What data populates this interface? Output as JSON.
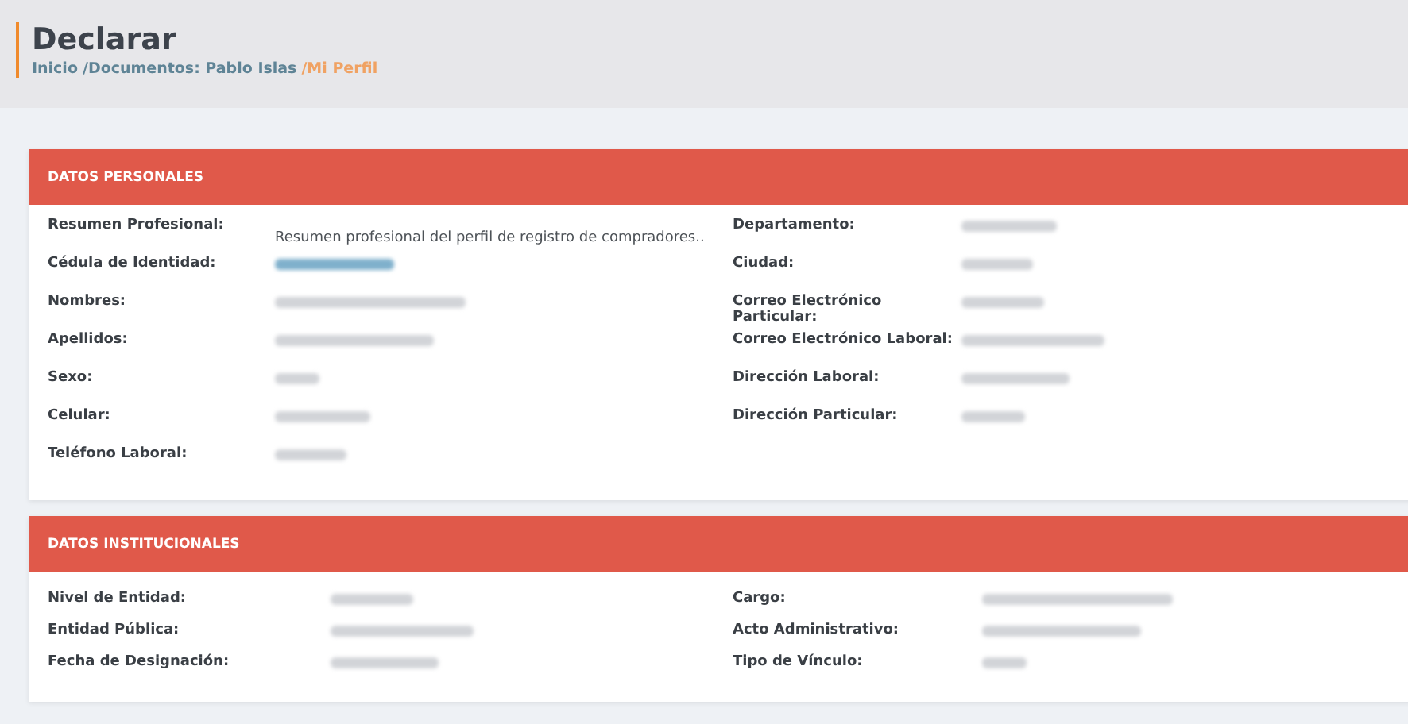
{
  "page_header": {
    "title": "Declarar",
    "breadcrumb": [
      {
        "label": "Inicio",
        "current": false
      },
      {
        "label": "/Documentos: Pablo Islas",
        "current": false
      },
      {
        "label": "/Mi Perfil",
        "current": true
      }
    ]
  },
  "sections": [
    {
      "title": "DATOS PERSONALES",
      "columns": [
        [
          {
            "label": "Resumen Profesional:",
            "kind": "text",
            "value": "Resumen profesional del perfil de registro de compradores.."
          },
          {
            "label": "Cédula de Identidad:",
            "kind": "blurred-link"
          },
          {
            "label": "Nombres:",
            "kind": "blurred"
          },
          {
            "label": "Apellidos:",
            "kind": "blurred"
          },
          {
            "label": "Sexo:",
            "kind": "blurred"
          },
          {
            "label": "Celular:",
            "kind": "blurred"
          },
          {
            "label": "Teléfono Laboral:",
            "kind": "blurred"
          }
        ],
        [
          {
            "label": "Departamento:",
            "kind": "blurred"
          },
          {
            "label": "Ciudad:",
            "kind": "blurred"
          },
          {
            "label": "Correo Electrónico Particular:",
            "kind": "blurred"
          },
          {
            "label": "Correo Electrónico Laboral:",
            "kind": "blurred"
          },
          {
            "label": "Dirección Laboral:",
            "kind": "blurred"
          },
          {
            "label": "Dirección Particular:",
            "kind": "blurred"
          }
        ]
      ]
    },
    {
      "title": "DATOS INSTITUCIONALES",
      "columns": [
        [
          {
            "label": "Nivel de Entidad:",
            "kind": "blurred"
          },
          {
            "label": "Entidad Pública:",
            "kind": "blurred"
          },
          {
            "label": "Fecha de Designación:",
            "kind": "blurred"
          }
        ],
        [
          {
            "label": "Cargo:",
            "kind": "blurred"
          },
          {
            "label": "Acto Administrativo:",
            "kind": "blurred"
          },
          {
            "label": "Tipo de Vínculo:",
            "kind": "blurred"
          }
        ]
      ]
    }
  ]
}
